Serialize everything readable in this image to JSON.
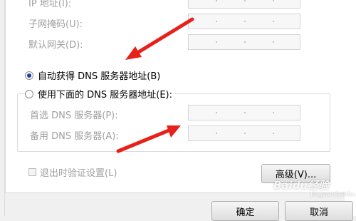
{
  "ip_section": {
    "ip_label": "IP 地址(I):",
    "subnet_label": "子网掩码(U):",
    "gateway_label": "默认网关(D):"
  },
  "dns": {
    "auto_label": "自动获得 DNS 服务器地址(B)",
    "manual_label": "使用下面的 DNS 服务器地址(E):",
    "preferred_label": "首选 DNS 服务器(P):",
    "alternate_label": "备用 DNS 服务器(A):",
    "selected": "auto"
  },
  "validate_label": "退出时验证设置(L)",
  "advanced_label": "高级(V)...",
  "ok_label": "确定",
  "cancel_label": "取消",
  "watermark": {
    "brand": "Baidu经验",
    "sub": "jingyan.baidu.com"
  },
  "colors": {
    "arrow": "#e8201a",
    "radio_selected": "#1a3f9c",
    "disabled_text": "#a0a0a0"
  }
}
